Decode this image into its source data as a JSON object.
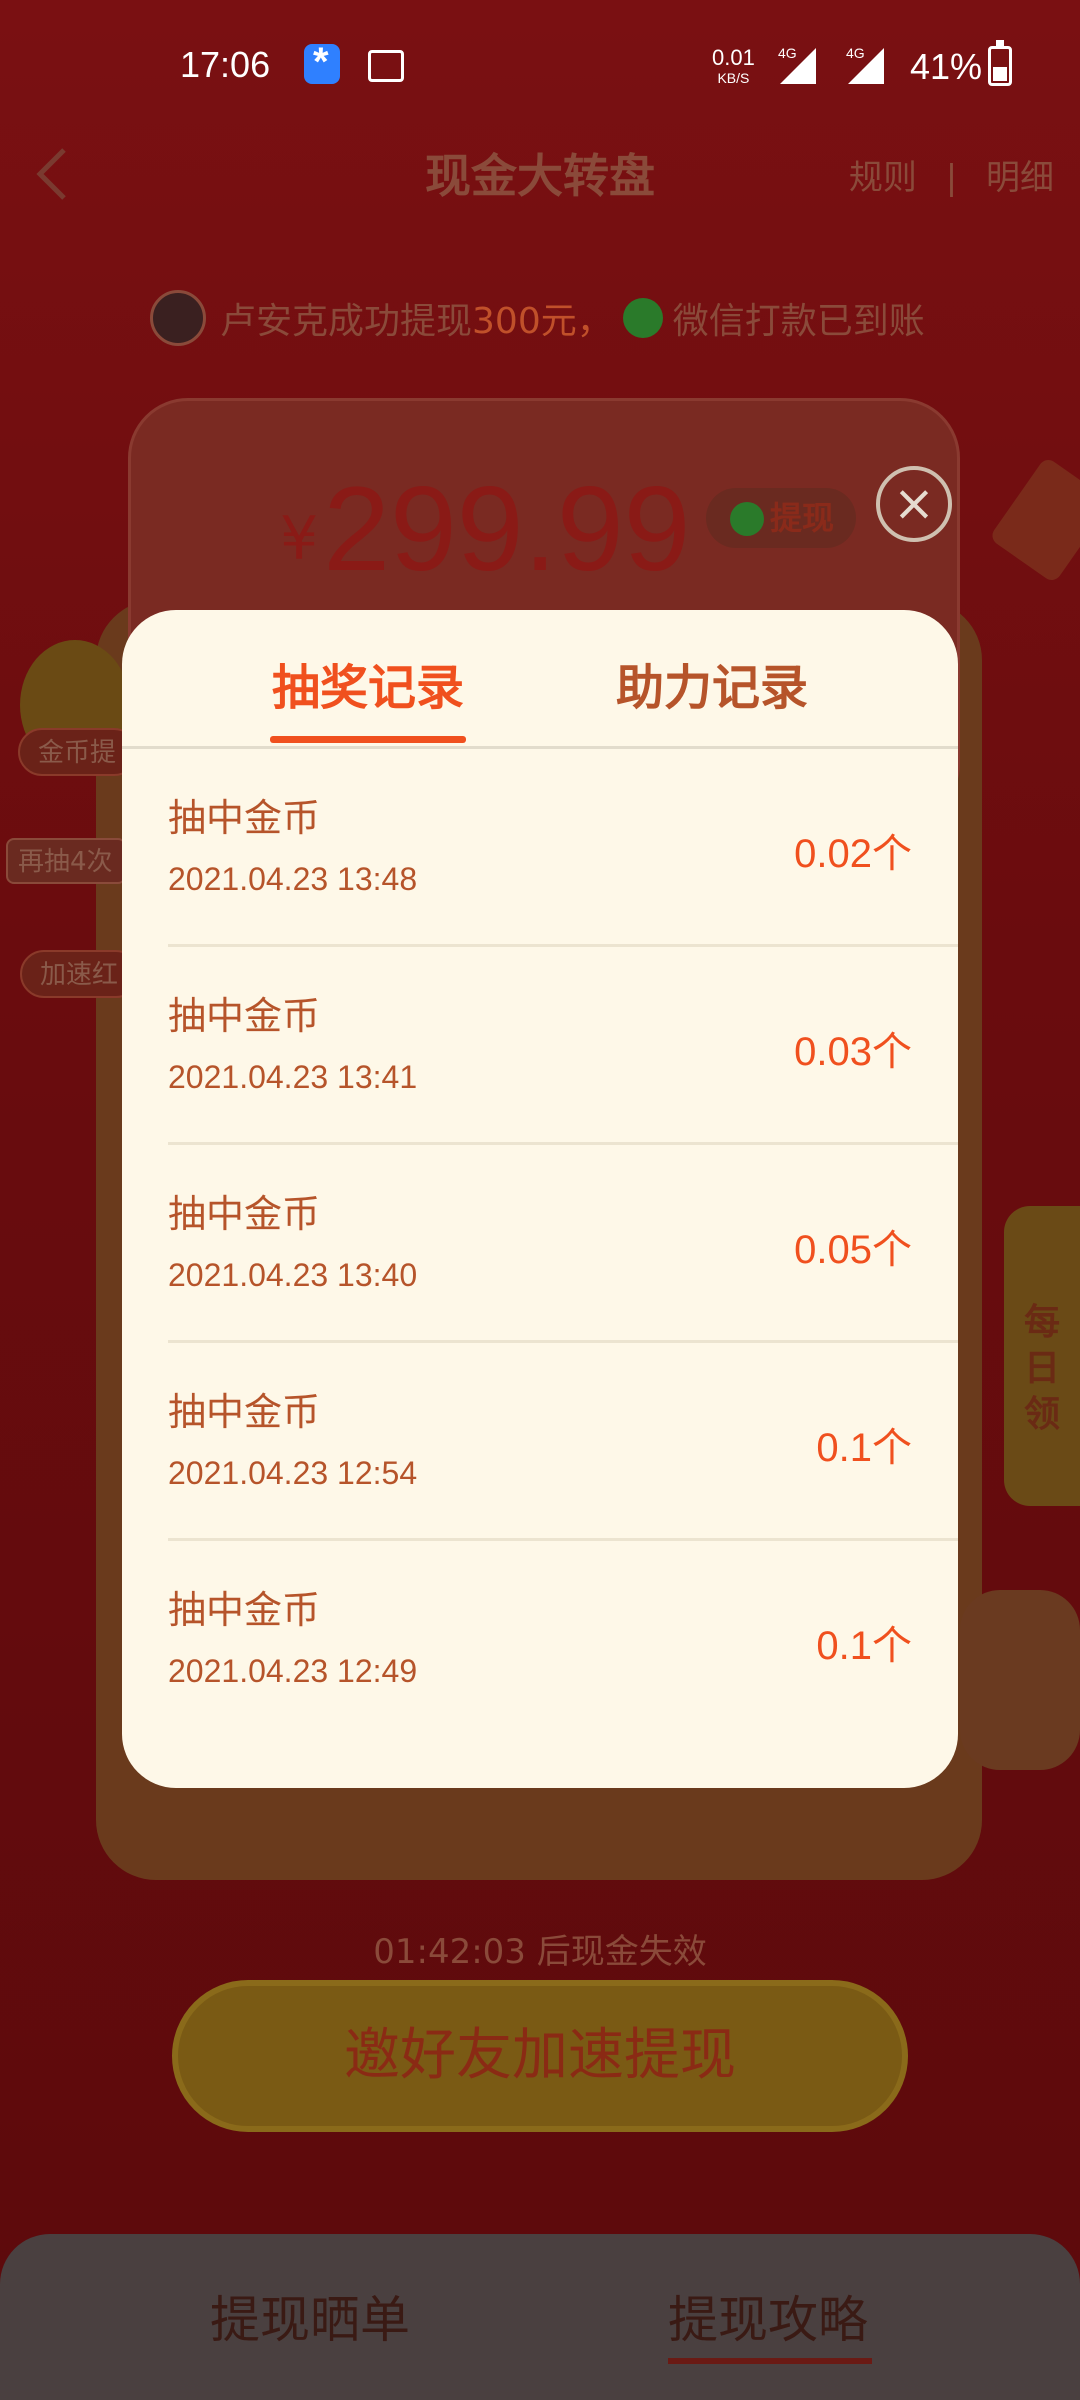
{
  "status_bar": {
    "time": "17:06",
    "net_speed": "0.01",
    "net_unit": "KB/S",
    "signal1": "4G",
    "signal2": "4G",
    "battery": "41%"
  },
  "nav": {
    "title": "现金大转盘",
    "rules": "规则",
    "separator": "|",
    "details": "明细"
  },
  "ticker": {
    "text_prefix": "卢安克成功提现",
    "amount": "300元，",
    "text_suffix": "微信打款已到账"
  },
  "prize": {
    "currency": "¥",
    "amount": "299.99",
    "withdraw_label": "提现"
  },
  "side": {
    "coin_withdraw": "金币提",
    "again_draw": "再抽4次",
    "speed_redpack": "加速红",
    "daily": "每日领"
  },
  "countdown": "01:42:03 后现金失效",
  "invite_button": "邀好友加速提现",
  "bottom_tabs": [
    {
      "label": "提现晒单"
    },
    {
      "label": "提现攻略"
    }
  ],
  "modal": {
    "tabs": [
      {
        "label": "抽奖记录"
      },
      {
        "label": "助力记录"
      }
    ],
    "active_tab": "抽奖记录",
    "records": [
      {
        "title": "抽中金币",
        "time": "2021.04.23 13:48",
        "amount": "0.02个"
      },
      {
        "title": "抽中金币",
        "time": "2021.04.23 13:41",
        "amount": "0.03个"
      },
      {
        "title": "抽中金币",
        "time": "2021.04.23 13:40",
        "amount": "0.05个"
      },
      {
        "title": "抽中金币",
        "time": "2021.04.23 12:54",
        "amount": "0.1个"
      },
      {
        "title": "抽中金币",
        "time": "2021.04.23 12:49",
        "amount": "0.1个"
      }
    ]
  },
  "colors": {
    "accent": "#f0501e",
    "modal_bg": "#fef8e8",
    "text_brown": "#b6542a"
  }
}
